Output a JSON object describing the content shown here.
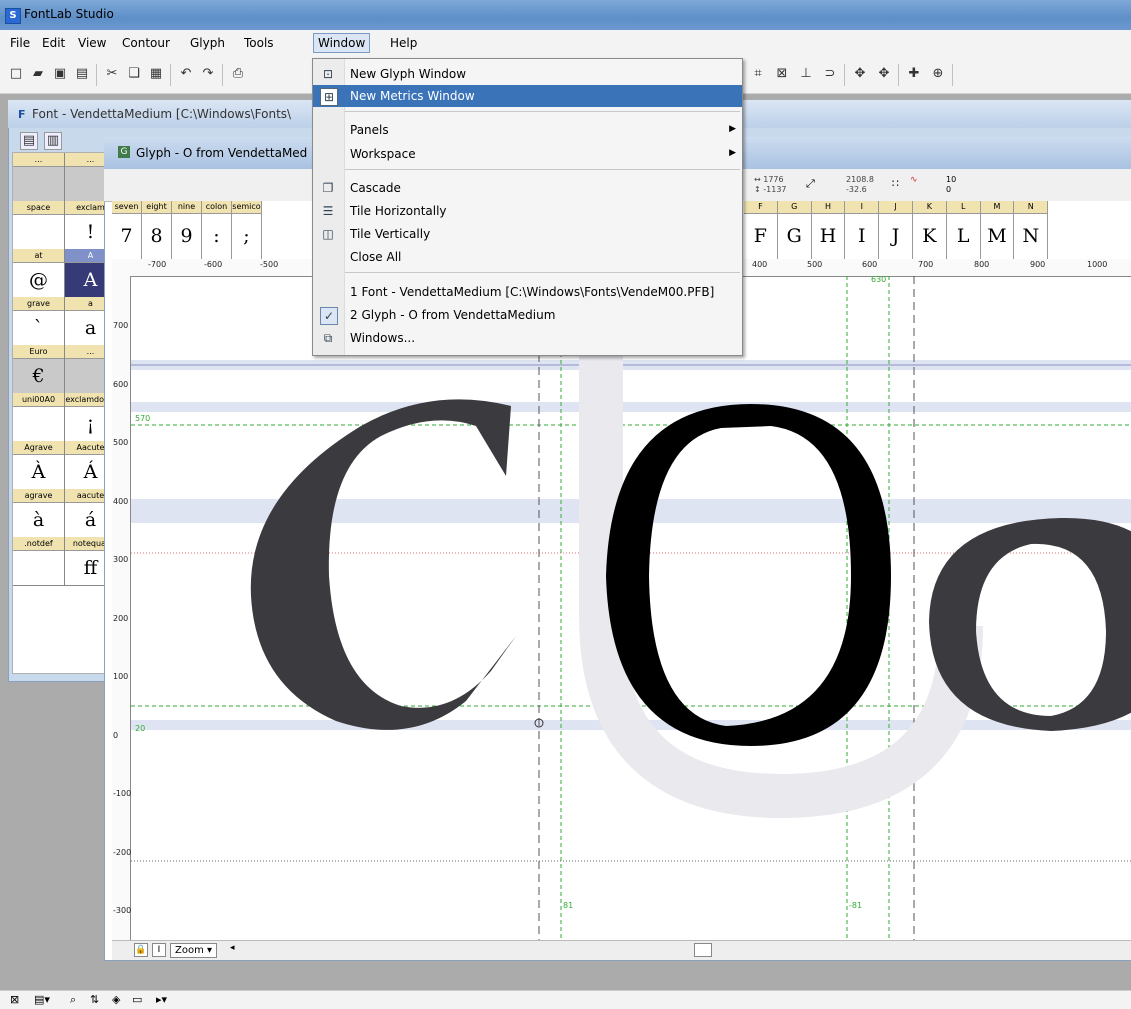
{
  "app": {
    "title": "FontLab Studio",
    "icon_letter": "S"
  },
  "menubar": {
    "items": [
      "File",
      "Edit",
      "View",
      "Contour",
      "Glyph",
      "Tools",
      "Window",
      "Help"
    ],
    "open_menu": "Window"
  },
  "font_window": {
    "icon_letter": "F",
    "title": "Font - VendettaMedium [C:\\Windows\\Fonts\\"
  },
  "font_grid": [
    {
      "label": "...",
      "char": "",
      "empty": true
    },
    {
      "label": "...",
      "char": "",
      "empty": true
    },
    {
      "label": "space",
      "char": "",
      "empty": false
    },
    {
      "label": "exclam",
      "char": "!",
      "empty": false
    },
    {
      "label": "at",
      "char": "@",
      "empty": false
    },
    {
      "label": "A",
      "char": "A",
      "selected": true
    },
    {
      "label": "grave",
      "char": "`",
      "empty": false
    },
    {
      "label": "a",
      "char": "a",
      "empty": false
    },
    {
      "label": "Euro",
      "char": "€",
      "empty": true
    },
    {
      "label": "...",
      "char": "",
      "empty": true
    },
    {
      "label": "uni00A0",
      "char": "",
      "empty": false
    },
    {
      "label": "exclamdown",
      "char": "¡",
      "empty": false
    },
    {
      "label": "Agrave",
      "char": "À",
      "empty": false
    },
    {
      "label": "Aacute",
      "char": "Á",
      "empty": false
    },
    {
      "label": "agrave",
      "char": "à",
      "empty": false
    },
    {
      "label": "aacute",
      "char": "á",
      "empty": false
    },
    {
      "label": ".notdef",
      "char": "",
      "empty": false
    },
    {
      "label": "notequal",
      "char": "ﬀ",
      "empty": false
    }
  ],
  "glyph_window": {
    "icon_letter": "G",
    "title": "Glyph - O from VendettaMed",
    "metrics": {
      "w": "1776",
      "h": "-1137",
      "dist": "2108.8",
      "angle": "-32.6",
      "count": "10",
      "zero": "0"
    },
    "strip": [
      {
        "label": "seven",
        "char": "7"
      },
      {
        "label": "eight",
        "char": "8"
      },
      {
        "label": "nine",
        "char": "9"
      },
      {
        "label": "colon",
        "char": ":"
      },
      {
        "label": "semico",
        "char": ";"
      }
    ],
    "strip_right": [
      {
        "label": "F",
        "char": "F"
      },
      {
        "label": "G",
        "char": "G"
      },
      {
        "label": "H",
        "char": "H"
      },
      {
        "label": "I",
        "char": "I"
      },
      {
        "label": "J",
        "char": "J"
      },
      {
        "label": "K",
        "char": "K"
      },
      {
        "label": "L",
        "char": "L"
      },
      {
        "label": "M",
        "char": "M"
      },
      {
        "label": "N",
        "char": "N"
      }
    ],
    "hruler_labels": [
      "-700",
      "-600",
      "-500",
      "400",
      "500",
      "600",
      "700",
      "800",
      "900",
      "1000"
    ],
    "vruler_labels": [
      "700",
      "600",
      "500",
      "400",
      "300",
      "200",
      "100",
      "0",
      "-100",
      "-200",
      "-300"
    ],
    "guide_labels": {
      "g570": "570",
      "g20": "20",
      "g630": "630",
      "g81": "81",
      "gm81": "-81"
    },
    "zoom_label": "Zoom"
  },
  "window_menu": {
    "items": [
      {
        "key": "new_glyph",
        "label": "New Glyph Window",
        "icon": "glyph-window-icon",
        "glyph": "⊡"
      },
      {
        "key": "new_metrics",
        "label": "New Metrics Window",
        "icon": "metrics-window-icon",
        "glyph": "⊞",
        "highlighted": true
      },
      {
        "key": "panels",
        "label": "Panels",
        "submenu": true
      },
      {
        "key": "workspace",
        "label": "Workspace",
        "submenu": true
      },
      {
        "key": "cascade",
        "label": "Cascade",
        "icon": "cascade-icon",
        "glyph": "❐"
      },
      {
        "key": "tile_h",
        "label": "Tile Horizontally",
        "icon": "tile-horizontal-icon",
        "glyph": "☰"
      },
      {
        "key": "tile_v",
        "label": "Tile Vertically",
        "icon": "tile-vertical-icon",
        "glyph": "◫"
      },
      {
        "key": "close_all",
        "label": "Close All"
      },
      {
        "key": "win1",
        "label": "1 Font - VendettaMedium [C:\\Windows\\Fonts\\VendeM00.PFB]"
      },
      {
        "key": "win2",
        "label": "2 Glyph - O from VendettaMedium",
        "checked": true
      },
      {
        "key": "windows",
        "label": "Windows...",
        "icon": "windows-list-icon",
        "glyph": "⧉"
      }
    ],
    "check_glyph": "✓",
    "submenu_arrow": "▶"
  },
  "canvas_letters": {
    "left": "C",
    "center": "O",
    "right": "o",
    "ghost": "U"
  },
  "colors": {
    "selection": "#3b73b9",
    "guide_green": "#33aa33",
    "band": "#c8d4ec"
  }
}
